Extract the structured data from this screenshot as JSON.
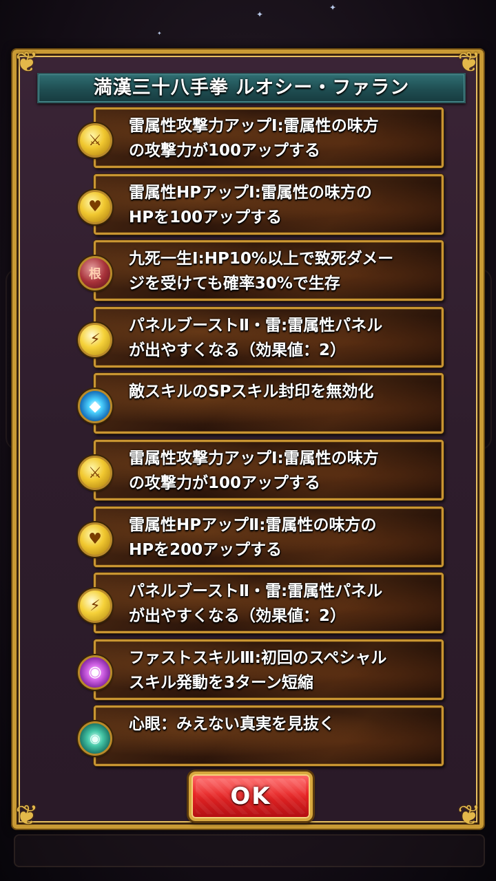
{
  "dialog": {
    "title": "満漢三十八手拳 ルオシー・ファラン",
    "ok_label": "OK"
  },
  "skills": [
    {
      "icon": "attack-up-icon",
      "text": "雷属性攻撃力アップⅠ:雷属性の味方\nの攻撃力が100アップする"
    },
    {
      "icon": "hp-up-icon",
      "text": "雷属性HPアップⅠ:雷属性の味方の\nHPを100アップする"
    },
    {
      "icon": "guts-icon",
      "text": "九死一生Ⅰ:HP10%以上で致死ダメー\nジを受けても確率30%で生存"
    },
    {
      "icon": "panel-boost-icon",
      "text": "パネルブーストⅡ・雷:雷属性パネル\nが出やすくなる（効果値：2）"
    },
    {
      "icon": "sp-seal-guard-icon",
      "text": "敵スキルのSPスキル封印を無効化"
    },
    {
      "icon": "attack-up-icon",
      "text": "雷属性攻撃力アップⅠ:雷属性の味方\nの攻撃力が100アップする"
    },
    {
      "icon": "hp-up-icon",
      "text": "雷属性HPアップⅡ:雷属性の味方の\nHPを200アップする"
    },
    {
      "icon": "panel-boost-icon",
      "text": "パネルブーストⅡ・雷:雷属性パネル\nが出やすくなる（効果値：2）"
    },
    {
      "icon": "fast-skill-icon",
      "text": "ファストスキルⅢ:初回のスペシャル\nスキル発動を3ターン短縮"
    },
    {
      "icon": "eye-icon",
      "text": "心眼：みえない真実を見抜く"
    }
  ]
}
